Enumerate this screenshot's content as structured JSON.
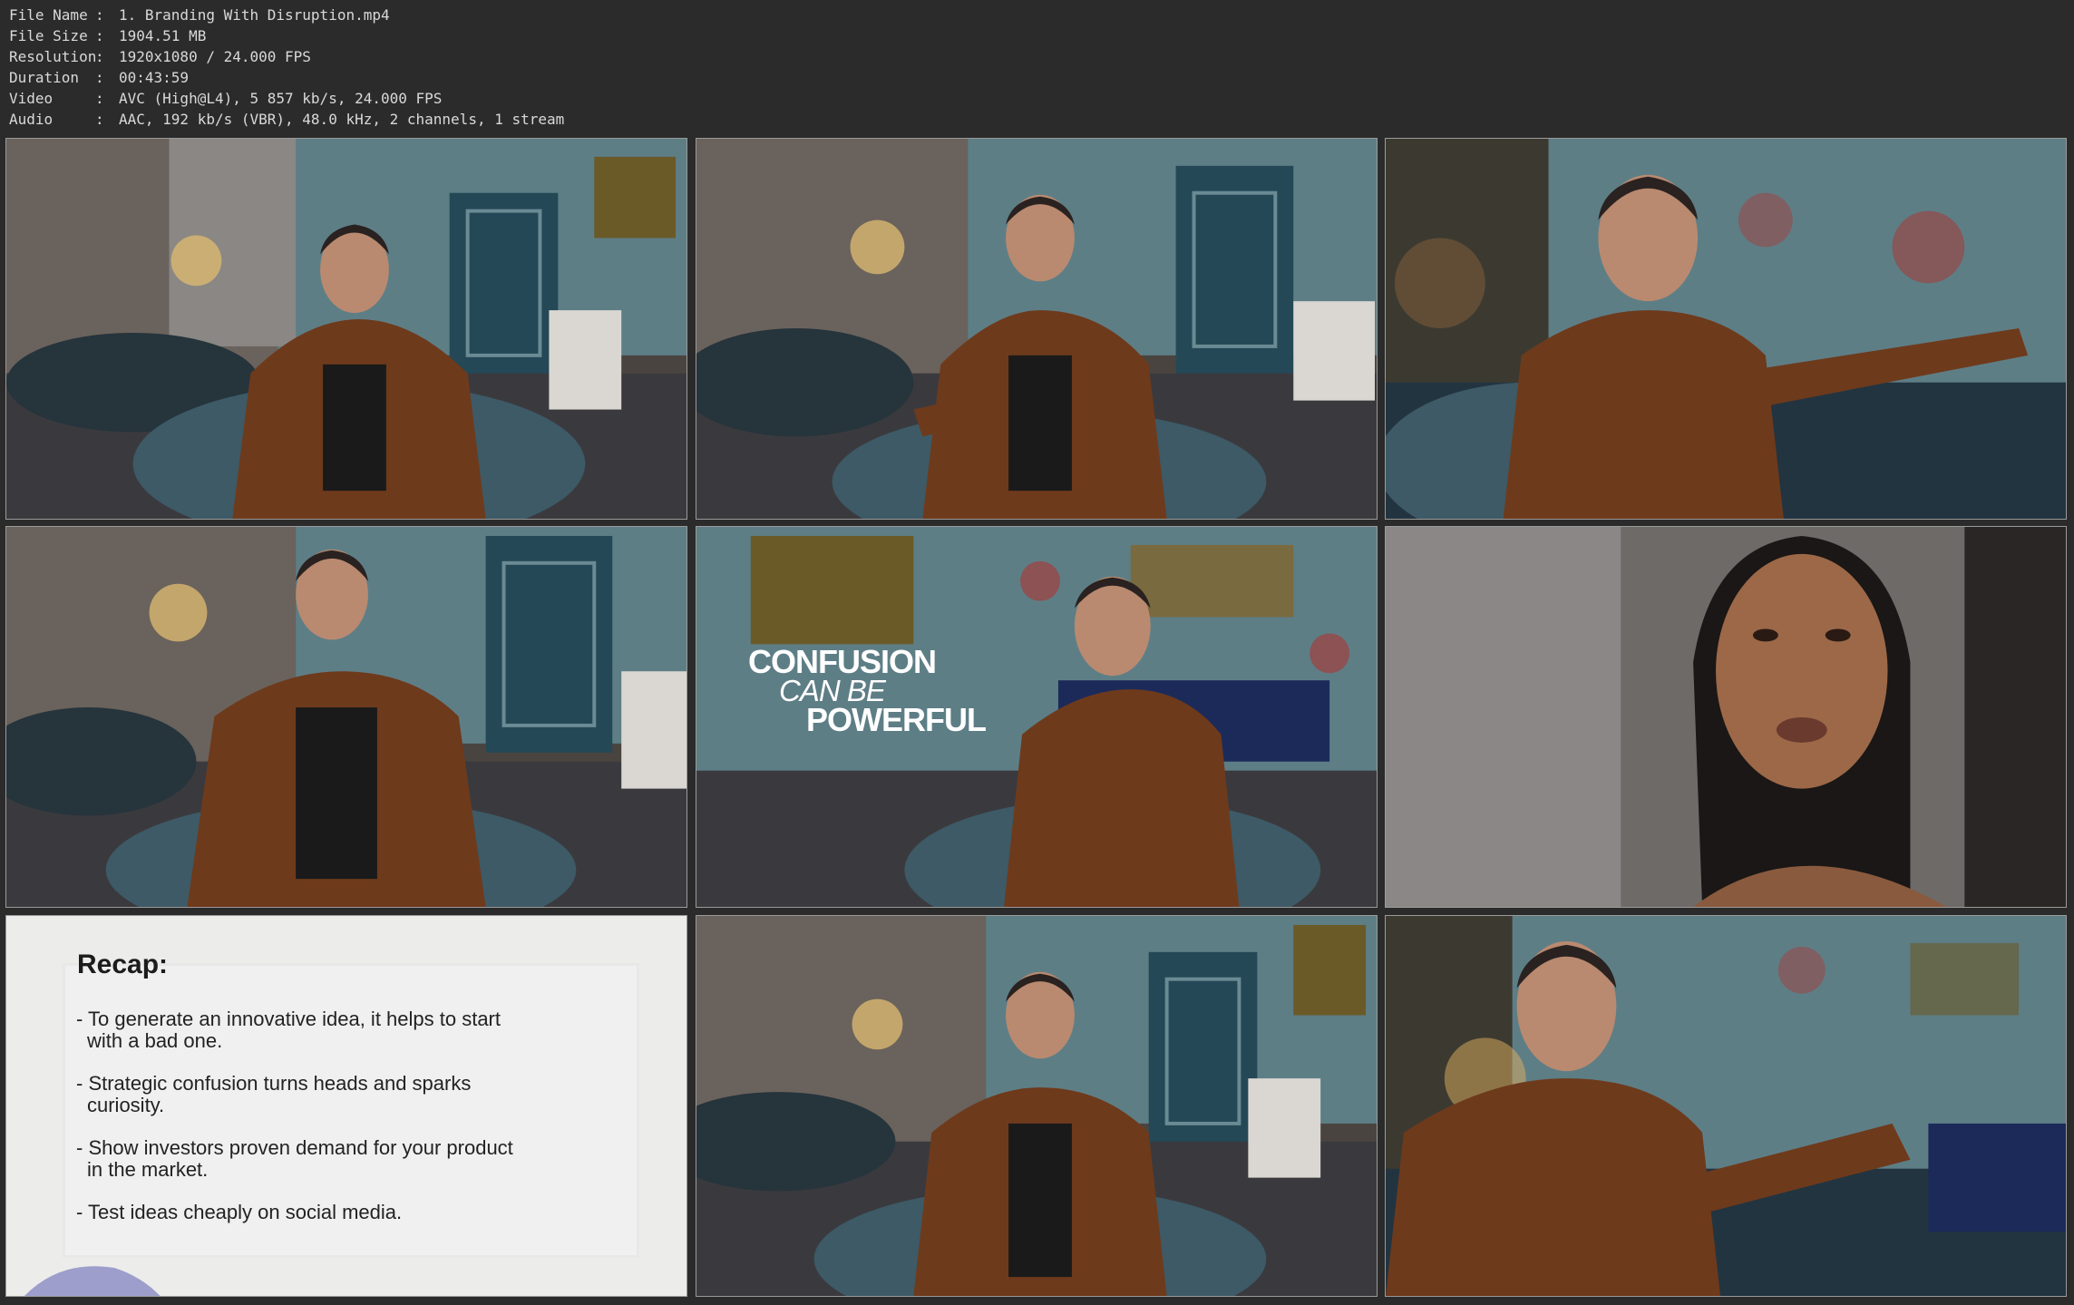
{
  "file_info": [
    {
      "key": "File Name",
      "value": "1. Branding With Disruption.mp4"
    },
    {
      "key": "File Size",
      "value": "1904.51 MB"
    },
    {
      "key": "Resolution",
      "value": "1920x1080 / 24.000 FPS"
    },
    {
      "key": "Duration",
      "value": "00:43:59"
    },
    {
      "key": "Video",
      "value": "AVC (High@L4), 5 857 kb/s, 24.000 FPS"
    },
    {
      "key": "Audio",
      "value": "AAC, 192 kb/s (VBR), 48.0 kHz, 2 channels, 1 stream"
    }
  ],
  "separator": ":",
  "overlay": {
    "line1": "CONFUSION",
    "line2": "CAN BE",
    "line3": "POWERFUL"
  },
  "recap": {
    "title": "Recap:",
    "items": [
      "- To generate an innovative idea, it helps to start with a bad one.",
      "- Strategic confusion turns heads and sparks curiosity.",
      "- Show investors proven demand for your product in the market.",
      "- Test ideas cheaply on social media."
    ]
  },
  "colors": {
    "background": "#2b2b2b",
    "text": "#d9d9d9",
    "thumb_border": "#9a9a9a",
    "jacket": "#6e3a1c",
    "wallpaper": "#5e7e86",
    "sofa": "#3d5a66"
  }
}
